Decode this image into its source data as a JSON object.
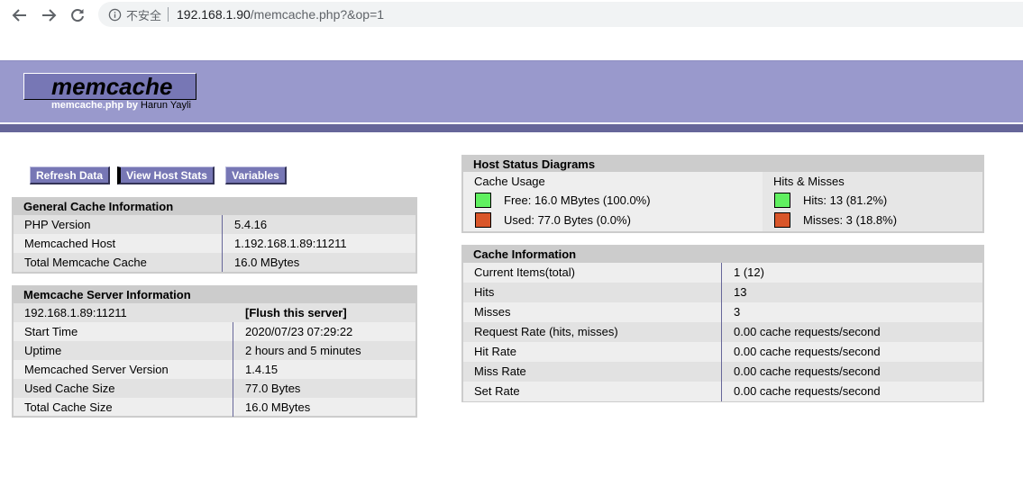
{
  "browser": {
    "security_label": "不安全",
    "url_host": "192.168.1.90",
    "url_path": "/memcache.php?&op=1"
  },
  "header": {
    "logo": "memcache",
    "subtitle_prefix": "memcache.php by",
    "author": "Harun Yayli"
  },
  "menu": {
    "refresh": "Refresh Data",
    "host_stats": "View Host Stats",
    "variables": "Variables"
  },
  "general": {
    "title": "General Cache Information",
    "rows": [
      {
        "k": "PHP Version",
        "v": "5.4.16"
      },
      {
        "k": "Memcached Host",
        "v": "1.192.168.1.89:11211"
      },
      {
        "k": "Total Memcache Cache",
        "v": "16.0 MBytes"
      }
    ]
  },
  "server": {
    "title": "Memcache Server Information",
    "host": "192.168.1.89:11211",
    "flush": "[Flush this server]",
    "rows": [
      {
        "k": "Start Time",
        "v": "2020/07/23 07:29:22"
      },
      {
        "k": "Uptime",
        "v": "2 hours and 5 minutes"
      },
      {
        "k": "Memcached Server Version",
        "v": "1.4.15"
      },
      {
        "k": "Used Cache Size",
        "v": "77.0 Bytes"
      },
      {
        "k": "Total Cache Size",
        "v": "16.0 MBytes"
      }
    ]
  },
  "diagrams": {
    "title": "Host Status Diagrams",
    "cache_usage": "Cache Usage",
    "free": "Free: 16.0 MBytes (100.0%)",
    "used": "Used: 77.0 Bytes (0.0%)",
    "hits_misses": "Hits & Misses",
    "hits": "Hits: 13 (81.2%)",
    "misses": "Misses: 3 (18.8%)",
    "colors": {
      "green": "#60f060",
      "orange": "#d9562a"
    }
  },
  "cache_info": {
    "title": "Cache Information",
    "rows": [
      {
        "k": "Current Items(total)",
        "v": "1 (12)"
      },
      {
        "k": "Hits",
        "v": "13"
      },
      {
        "k": "Misses",
        "v": "3"
      },
      {
        "k": "Request Rate (hits, misses)",
        "v": "0.00 cache requests/second"
      },
      {
        "k": "Hit Rate",
        "v": "0.00 cache requests/second"
      },
      {
        "k": "Miss Rate",
        "v": "0.00 cache requests/second"
      },
      {
        "k": "Set Rate",
        "v": "0.00 cache requests/second"
      }
    ]
  }
}
